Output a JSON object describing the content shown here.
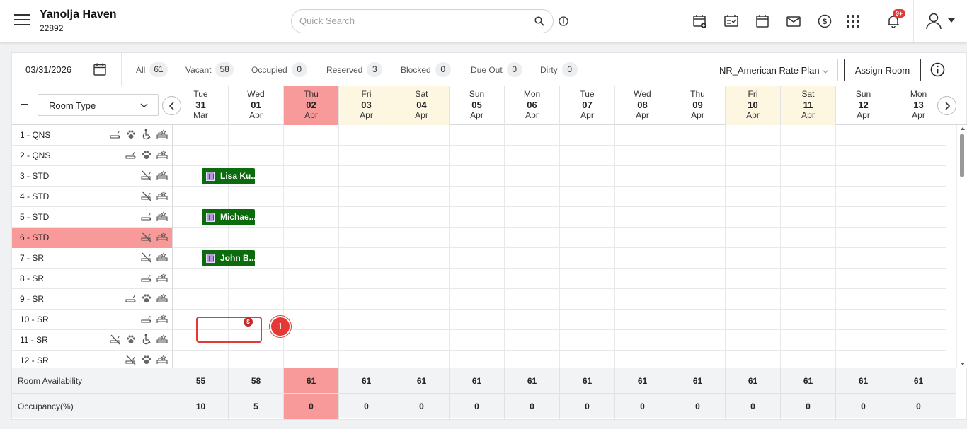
{
  "header": {
    "hotel_name": "Yanolja Haven",
    "hotel_id": "22892",
    "search_placeholder": "Quick Search",
    "notification_badge": "9+"
  },
  "filters": {
    "date": "03/31/2026",
    "stats": [
      {
        "label": "All",
        "count": "61"
      },
      {
        "label": "Vacant",
        "count": "58"
      },
      {
        "label": "Occupied",
        "count": "0"
      },
      {
        "label": "Reserved",
        "count": "3"
      },
      {
        "label": "Blocked",
        "count": "0"
      },
      {
        "label": "Due Out",
        "count": "0"
      },
      {
        "label": "Dirty",
        "count": "0"
      }
    ],
    "rate_plan": "NR_American Rate Plan",
    "assign_room_label": "Assign Room"
  },
  "grid": {
    "room_type_label": "Room Type",
    "days": [
      {
        "dow": "Tue",
        "day": "31",
        "mon": "Mar",
        "kind": "normal"
      },
      {
        "dow": "Wed",
        "day": "01",
        "mon": "Apr",
        "kind": "normal"
      },
      {
        "dow": "Thu",
        "day": "02",
        "mon": "Apr",
        "kind": "today"
      },
      {
        "dow": "Fri",
        "day": "03",
        "mon": "Apr",
        "kind": "weekend"
      },
      {
        "dow": "Sat",
        "day": "04",
        "mon": "Apr",
        "kind": "weekend"
      },
      {
        "dow": "Sun",
        "day": "05",
        "mon": "Apr",
        "kind": "normal"
      },
      {
        "dow": "Mon",
        "day": "06",
        "mon": "Apr",
        "kind": "normal"
      },
      {
        "dow": "Tue",
        "day": "07",
        "mon": "Apr",
        "kind": "normal"
      },
      {
        "dow": "Wed",
        "day": "08",
        "mon": "Apr",
        "kind": "normal"
      },
      {
        "dow": "Thu",
        "day": "09",
        "mon": "Apr",
        "kind": "normal"
      },
      {
        "dow": "Fri",
        "day": "10",
        "mon": "Apr",
        "kind": "weekend"
      },
      {
        "dow": "Sat",
        "day": "11",
        "mon": "Apr",
        "kind": "weekend"
      },
      {
        "dow": "Sun",
        "day": "12",
        "mon": "Apr",
        "kind": "normal"
      },
      {
        "dow": "Mon",
        "day": "13",
        "mon": "Apr",
        "kind": "normal"
      }
    ],
    "rooms": [
      {
        "name": "1 - QNS",
        "icons": [
          "smoking",
          "pet",
          "wheelchair",
          "bed"
        ]
      },
      {
        "name": "2 - QNS",
        "icons": [
          "smoking",
          "pet",
          "bed"
        ]
      },
      {
        "name": "3 - STD",
        "icons": [
          "nonsmoking",
          "bed"
        ]
      },
      {
        "name": "4 - STD",
        "icons": [
          "nonsmoking",
          "bed"
        ]
      },
      {
        "name": "5 - STD",
        "icons": [
          "smoking",
          "bed"
        ]
      },
      {
        "name": "6 - STD",
        "icons": [
          "nonsmoking",
          "bed"
        ],
        "highlight": true
      },
      {
        "name": "7 - SR",
        "icons": [
          "nonsmoking",
          "bed"
        ]
      },
      {
        "name": "8 - SR",
        "icons": [
          "smoking",
          "bed"
        ]
      },
      {
        "name": "9 - SR",
        "icons": [
          "smoking",
          "pet",
          "bed"
        ]
      },
      {
        "name": "10 - SR",
        "icons": [
          "smoking",
          "bed"
        ]
      },
      {
        "name": "11 - SR",
        "icons": [
          "nonsmoking",
          "pet",
          "wheelchair",
          "bed"
        ]
      },
      {
        "name": "12 - SR",
        "icons": [
          "nonsmoking",
          "pet",
          "bed"
        ]
      }
    ],
    "bookings": [
      {
        "guest": "Lisa Ku...",
        "room_index": 2
      },
      {
        "guest": "Michae...",
        "room_index": 4
      },
      {
        "guest": "John B...",
        "room_index": 6,
        "badge": "$"
      }
    ],
    "step_marker": "1"
  },
  "footer": {
    "availability_label": "Room Availability",
    "availability": [
      "55",
      "58",
      "61",
      "61",
      "61",
      "61",
      "61",
      "61",
      "61",
      "61",
      "61",
      "61",
      "61",
      "61"
    ],
    "occupancy_label": "Occupancy(%)",
    "occupancy": [
      "10",
      "5",
      "0",
      "0",
      "0",
      "0",
      "0",
      "0",
      "0",
      "0",
      "0",
      "0",
      "0",
      "0"
    ]
  },
  "colors": {
    "today": "#f99a9a",
    "weekend": "#fdf7e1",
    "booking": "#0c6b0c",
    "accent_red": "#e53935"
  }
}
